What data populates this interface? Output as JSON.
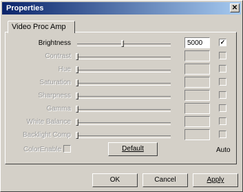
{
  "window": {
    "title": "Properties",
    "close_glyph": "✕"
  },
  "tabs": [
    {
      "label": "Video Proc Amp"
    }
  ],
  "controls": [
    {
      "label": "Brightness",
      "value": "5000",
      "level": 0.5,
      "auto": true,
      "enabled": true
    },
    {
      "label": "Contrast",
      "value": "",
      "level": 0.0,
      "auto": false,
      "enabled": false
    },
    {
      "label": "Hue",
      "value": "",
      "level": 0.0,
      "auto": false,
      "enabled": false
    },
    {
      "label": "Saturation",
      "value": "",
      "level": 0.0,
      "auto": false,
      "enabled": false
    },
    {
      "label": "Sharpness",
      "value": "",
      "level": 0.0,
      "auto": false,
      "enabled": false
    },
    {
      "label": "Gamma",
      "value": "",
      "level": 0.0,
      "auto": false,
      "enabled": false
    },
    {
      "label": "White Balance",
      "value": "",
      "level": 0.0,
      "auto": false,
      "enabled": false
    },
    {
      "label": "Backlight Comp",
      "value": "",
      "level": 0.0,
      "auto": false,
      "enabled": false
    }
  ],
  "color_enable": {
    "label": "ColorEnable",
    "checked": false,
    "enabled": false
  },
  "default_button": "Default",
  "auto_label": "Auto",
  "buttons": {
    "ok": "OK",
    "cancel": "Cancel",
    "apply": "Apply"
  }
}
